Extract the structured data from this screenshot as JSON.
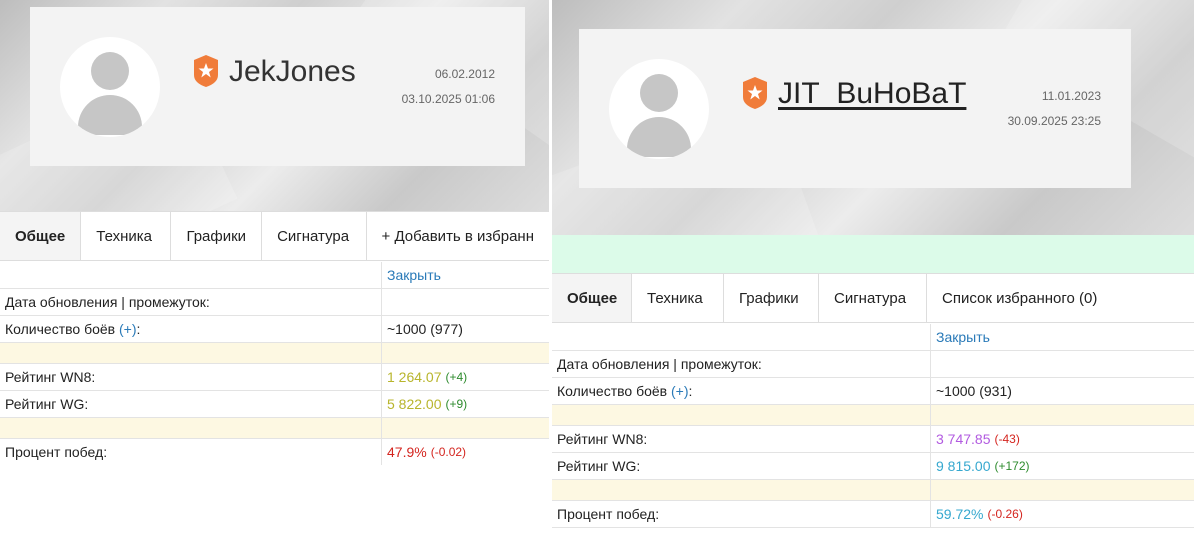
{
  "left": {
    "username": "JekJones",
    "date_registered": "06.02.2012",
    "date_updated": "03.10.2025 01:06",
    "tabs": [
      "Общее",
      "Техника",
      "Графики",
      "Сигнатура",
      "+ Добавить в избранн"
    ],
    "close_label": "Закрыть",
    "rows": {
      "update_label": "Дата обновления | промежуток:",
      "battles_label": "Количество боёв",
      "battles_plus": "(+)",
      "battles_colon": ":",
      "battles_value": "~1000 (977)",
      "wn8_label": "Рейтинг WN8:",
      "wn8_value": "1 264.07",
      "wn8_delta": "(+4)",
      "wg_label": "Рейтинг WG:",
      "wg_value": "5 822.00",
      "wg_delta": "(+9)",
      "win_label": "Процент побед:",
      "win_value": "47.9%",
      "win_delta": "(-0.02)"
    }
  },
  "right": {
    "username": "JIT_BuHoBaT",
    "date_registered": "11.01.2023",
    "date_updated": "30.09.2025 23:25",
    "tabs": [
      "Общее",
      "Техника",
      "Графики",
      "Сигнатура",
      "Список избранного (0)"
    ],
    "close_label": "Закрыть",
    "rows": {
      "update_label": "Дата обновления | промежуток:",
      "battles_label": "Количество боёв",
      "battles_plus": "(+)",
      "battles_colon": ":",
      "battles_value": "~1000 (931)",
      "wn8_label": "Рейтинг WN8:",
      "wn8_value": "3 747.85",
      "wn8_delta": "(-43)",
      "wg_label": "Рейтинг WG:",
      "wg_value": "9 815.00",
      "wg_delta": "(+172)",
      "win_label": "Процент побед:",
      "win_value": "59.72%",
      "win_delta": "(-0.26)"
    }
  },
  "colors": {
    "badge": "#f07c3a",
    "link": "#2a7ab8",
    "delta_positive": "#2e8b2e",
    "delta_negative": "#d4251f",
    "wn8_left": "#b8b52c",
    "wn8_right": "#b25be0",
    "rating_cyan": "#36a8cf",
    "winrate_left": "#d4251f",
    "highlight_row": "#fdf8e2",
    "notice_strip": "#dcfbe9"
  },
  "icons": [
    "avatar-placeholder-icon",
    "premium-star-badge-icon"
  ]
}
